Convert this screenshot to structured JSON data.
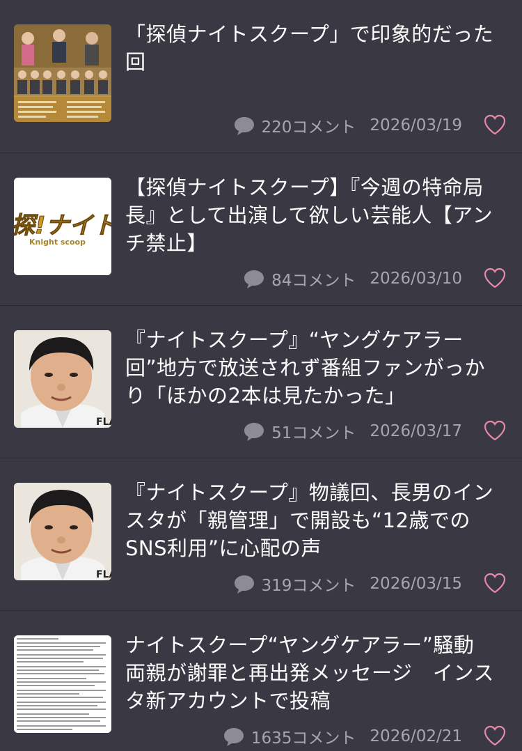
{
  "articles": [
    {
      "title": "「探偵ナイトスクープ」で印象的だった回",
      "comments": "220コメント",
      "date": "2026/03/19",
      "thumbnail": "tv-cast-photo"
    },
    {
      "title": "【探偵ナイトスクープ】『今週の特命局長』として出演して欲しい芸能人【アンチ禁止】",
      "comments": "84コメント",
      "date": "2026/03/10",
      "thumbnail": "knight-scoop-logo",
      "logo_text": "Knight scoop"
    },
    {
      "title": "『ナイトスクープ』“ヤングケアラー回”地方で放送されず番組ファンがっかり「ほかの2本は見たかった」",
      "comments": "51コメント",
      "date": "2026/03/17",
      "thumbnail": "person-photo",
      "watermark": "FLA"
    },
    {
      "title": "『ナイトスクープ』物議回、長男のインスタが「親管理」で開設も“12歳でのSNS利用”に心配の声",
      "comments": "319コメント",
      "date": "2026/03/15",
      "thumbnail": "person-photo",
      "watermark": "FLA"
    },
    {
      "title": "ナイトスクープ“ヤングケアラー”騒動　両親が謝罪と再出発メッセージ　インスタ新アカウントで投稿",
      "comments": "1635コメント",
      "date": "2026/02/21",
      "thumbnail": "document-screenshot"
    }
  ],
  "colors": {
    "background": "#3a3842",
    "divider": "#2b2a31",
    "title": "#ffffff",
    "meta": "#a8a6ad",
    "heart": "#e68aa8"
  },
  "icons": {
    "comment": "speech-bubble-icon",
    "like": "heart-icon"
  }
}
